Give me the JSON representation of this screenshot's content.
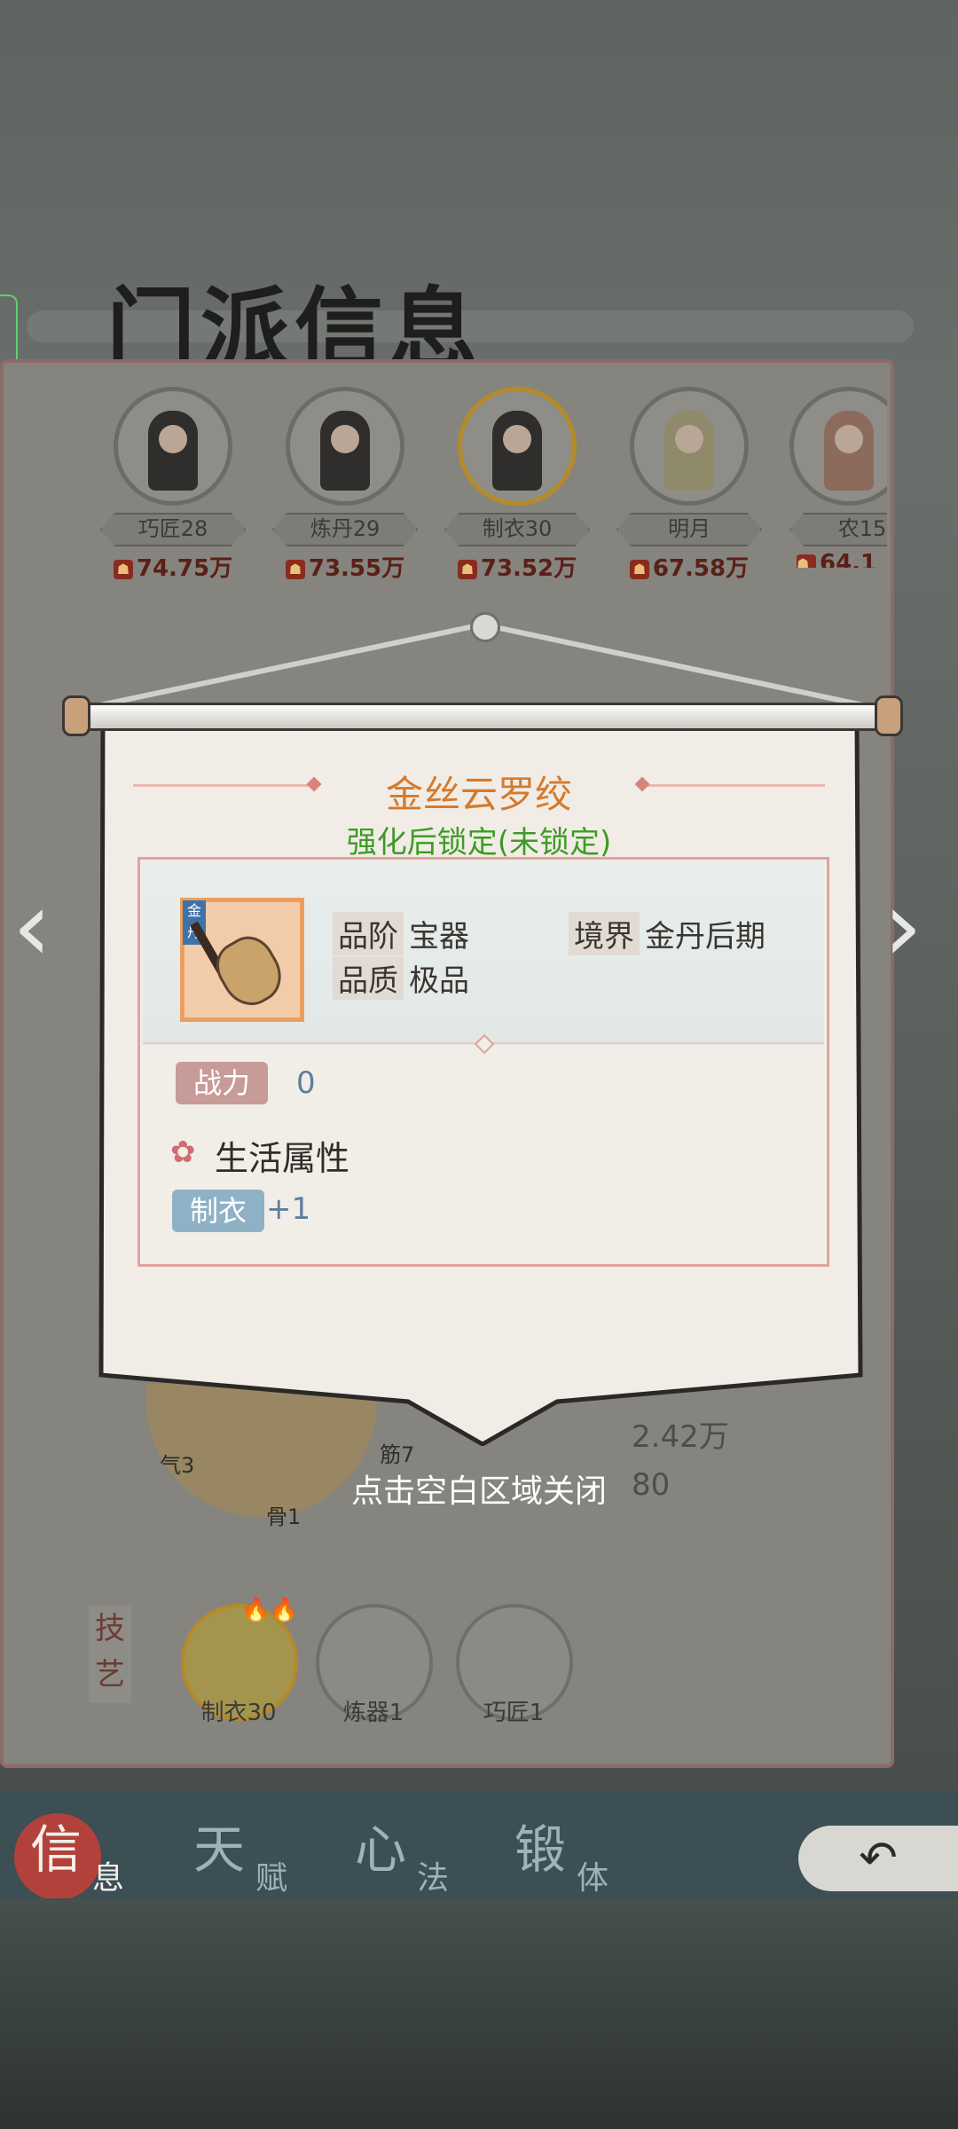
{
  "header": {
    "title": "门派信息"
  },
  "roster": [
    {
      "name": "巧匠28",
      "power": "74.75万",
      "highlight": false
    },
    {
      "name": "炼丹29",
      "power": "73.55万",
      "highlight": false
    },
    {
      "name": "制衣30",
      "power": "73.52万",
      "highlight": true
    },
    {
      "name": "明月",
      "power": "67.58万",
      "highlight": false
    },
    {
      "name": "农15",
      "power": "64.1",
      "highlight": false
    }
  ],
  "item_popup": {
    "name": "金丝云罗绞",
    "lock_status": "强化后锁定(未锁定)",
    "icon_badge": "金丹",
    "grade_label": "品阶",
    "grade_value": "宝器",
    "realm_label": "境界",
    "realm_value": "金丹后期",
    "quality_label": "品质",
    "quality_value": "极品",
    "power_label": "战力",
    "power_value": "0",
    "life_attr_title": "生活属性",
    "skill_label": "制衣",
    "skill_value": "+1"
  },
  "close_hint": "点击空白区域关闭",
  "background_stats": {
    "frag1": "2.42万",
    "frag2": "80",
    "radar_labels": [
      "气3",
      "骨1",
      "筋7"
    ]
  },
  "skills_section": {
    "label": "技艺",
    "items": [
      {
        "name": "制衣30",
        "icon": "cloth-spool-icon"
      },
      {
        "name": "炼器1",
        "icon": "anvil-icon"
      },
      {
        "name": "巧匠1",
        "icon": "hammer-icon"
      }
    ]
  },
  "bottom_tabs": [
    {
      "big": "信",
      "small": "息",
      "active": true
    },
    {
      "big": "天",
      "small": "赋",
      "active": false
    },
    {
      "big": "心",
      "small": "法",
      "active": false
    },
    {
      "big": "锻",
      "small": "体",
      "active": false
    }
  ],
  "colors": {
    "item_name": "#d47a2e",
    "lock_status": "#3f9a27",
    "power_chip": "#c69b98",
    "skill_chip": "#8fb1c6"
  }
}
